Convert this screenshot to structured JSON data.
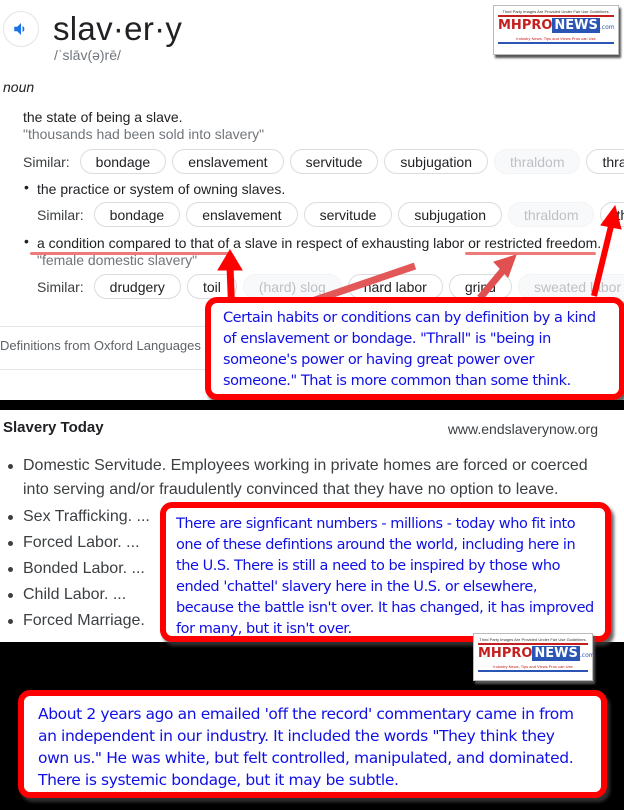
{
  "dictionary": {
    "headword": "slav·er·y",
    "phonetic": "/ˈslāv(ə)rē/",
    "part_of_speech": "noun",
    "similar_label": "Similar:",
    "senses": [
      {
        "definition": "the state of being a slave.",
        "example": "\"thousands had been sold into slavery\"",
        "similar": [
          {
            "word": "bondage",
            "faded": false
          },
          {
            "word": "enslavement",
            "faded": false
          },
          {
            "word": "servitude",
            "faded": false
          },
          {
            "word": "subjugation",
            "faded": false
          },
          {
            "word": "thraldom",
            "faded": true
          },
          {
            "word": "thrall",
            "faded": false
          }
        ],
        "has_expand": true
      },
      {
        "definition": "the practice or system of owning slaves.",
        "similar": [
          {
            "word": "bondage",
            "faded": false
          },
          {
            "word": "enslavement",
            "faded": false
          },
          {
            "word": "servitude",
            "faded": false
          },
          {
            "word": "subjugation",
            "faded": false
          },
          {
            "word": "thraldom",
            "faded": true
          },
          {
            "word": "thrall",
            "faded": false
          }
        ]
      },
      {
        "definition": "a condition compared to that of a slave in respect of exhausting labor or restricted freedom.",
        "example": "\"female domestic slavery\"",
        "similar": [
          {
            "word": "drudgery",
            "faded": false
          },
          {
            "word": "toil",
            "faded": false
          },
          {
            "word": "(hard) slog",
            "faded": true
          },
          {
            "word": "hard labor",
            "faded": false
          },
          {
            "word": "grind",
            "faded": false
          },
          {
            "word": "sweated labor",
            "faded": true
          }
        ],
        "has_expand": true
      }
    ],
    "source": "Definitions from Oxford Languages",
    "expand_icon": "chevron-down-icon",
    "speaker_icon": "speaker-icon"
  },
  "callouts": {
    "thrall_note": "Certain habits or conditions can by definition by a kind of enslavement or bondage. \"Thrall\" is \"being in someone's power or having great power over someone.\" That is more common than some think.",
    "millions_note": "There are signficant numbers - millions - today who fit into one of these defintions around the world, including here in the U.S. There is still a need to be inspired by those who ended 'chattel' slavery here in the U.S. or elsewhere, because the battle isn't over. It has changed, it has improved for many, but it isn't over.",
    "bondage_note": "About 2 years ago an emailed 'off the record' commentary came in from an independent in our industry. It included the words \"They think they own us.\" He was white, but felt controlled, manipulated, and dominated. There is systemic bondage, but it may be subtle."
  },
  "watermark": {
    "top_text": "Third Party Images Are Provided Under Fair Use Guidelines.",
    "brand_mh": "MH",
    "brand_pro": "PRO",
    "brand_news": "NEWS",
    "brand_com": ".com",
    "tagline": "Industry News, Tips and Views Pros can Use"
  },
  "slavery_today": {
    "title": "Slavery Today",
    "site": "www.endslaverynow.org",
    "items": [
      "Domestic Servitude. Employees working in private homes are forced or coerced",
      "into serving and/or fraudulently convinced that they have no option to leave.",
      "Sex Trafficking. ...",
      "Forced Labor. ...",
      "Bonded Labor. ...",
      "Child Labor. ...",
      "Forced Marriage."
    ]
  },
  "colors": {
    "callout_border": "#ff0000",
    "callout_text": "#1010e6",
    "underline": "#f07a7a",
    "google_blue": "#1a73e8"
  }
}
